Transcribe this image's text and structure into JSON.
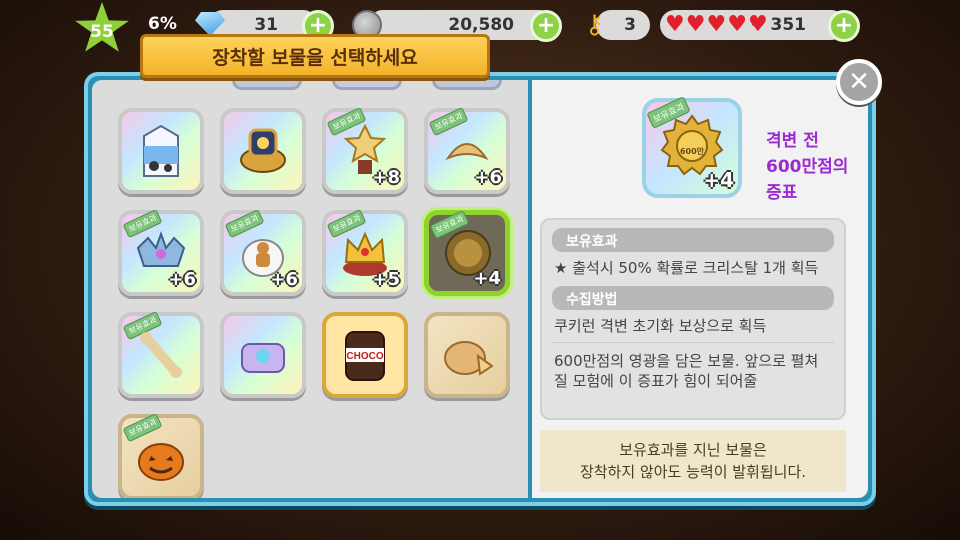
{
  "hud": {
    "level": "55",
    "exp_percent": "6%",
    "crystals": "31",
    "coins": "20,580",
    "keys": "3",
    "hearts_extra": "+ 351",
    "plus": "+"
  },
  "dialog": {
    "title": "장착할 보물을 선택하세요",
    "close_symbol": "✕"
  },
  "treasures": [
    {
      "id": "milk",
      "count": "",
      "style": "rainbow"
    },
    {
      "id": "compass",
      "count": "",
      "style": "rainbow"
    },
    {
      "id": "trophy-50",
      "count": "+8",
      "style": "rainbow",
      "badge": "보유효과"
    },
    {
      "id": "fortune-cookie",
      "count": "+6",
      "style": "rainbow",
      "badge": "보유효과"
    },
    {
      "id": "tiara",
      "count": "+6",
      "style": "rainbow",
      "badge": "보유효과"
    },
    {
      "id": "gingerbread-bag",
      "count": "+6",
      "style": "rainbow",
      "badge": "보유효과"
    },
    {
      "id": "crown",
      "count": "+5",
      "style": "rainbow",
      "badge": "보유효과"
    },
    {
      "id": "medal-600",
      "count": "+4",
      "style": "selected",
      "badge": "보유효과"
    },
    {
      "id": "bone",
      "count": "",
      "style": "rainbow",
      "badge": "보유효과"
    },
    {
      "id": "jewel-box",
      "count": "",
      "style": "rainbow"
    },
    {
      "id": "choco-jar",
      "count": "",
      "style": "plain",
      "label": "CHOCO"
    },
    {
      "id": "pie",
      "count": "",
      "style": "beige"
    },
    {
      "id": "pumpkin",
      "count": "",
      "style": "beige",
      "badge": "보유효과"
    }
  ],
  "detail": {
    "badge": "보유효과",
    "count": "+4",
    "medal_text": "600만",
    "name_line1": "격변 전",
    "name_line2": "600만점의 증표",
    "effect_header": "보유효과",
    "effect_text": "출석시 50% 확률로 크리스탈 1개 획득",
    "method_header": "수집방법",
    "method_text": "쿠키런 격변 초기화 보상으로 획득",
    "description": "600만점의 영광을 담은 보물. 앞으로 펼쳐질 모험에 이 증표가 힘이 되어줄",
    "notice_line1": "보유효과를 지닌 보물은",
    "notice_line2": "장착하지 않아도 능력이 발휘됩니다."
  },
  "colors": {
    "panel_border": "#2a8fb0",
    "title_ribbon": "#f4b32a",
    "selected": "#8ed22c",
    "detail_name": "#9b2bd0"
  }
}
